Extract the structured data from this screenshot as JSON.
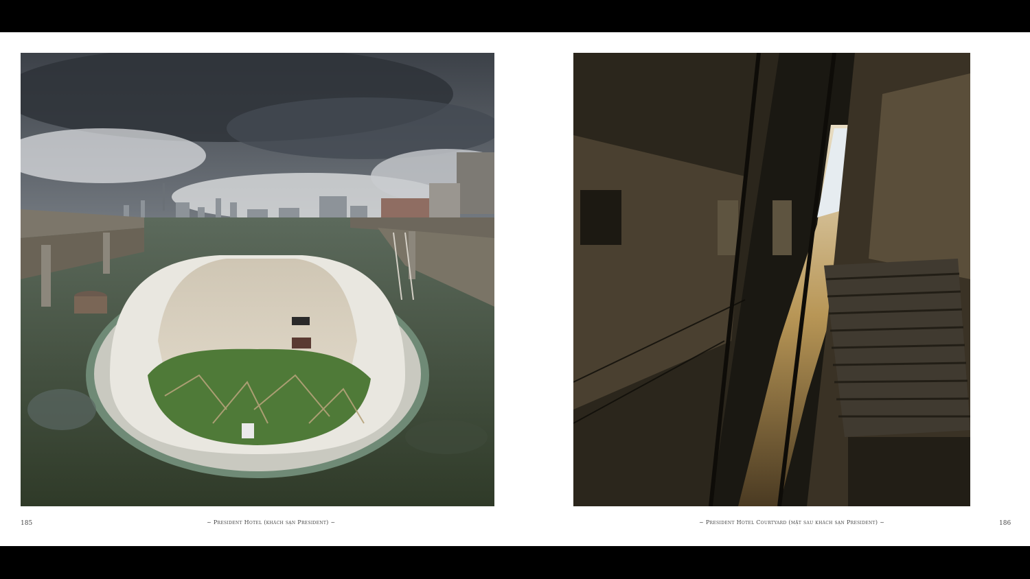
{
  "left_page": {
    "page_number": "185",
    "caption": "~ President Hotel (khách sạn President) ~"
  },
  "right_page": {
    "page_number": "186",
    "caption": "~ President Hotel Courtyard (mặt sau khách sạn President) ~"
  }
}
